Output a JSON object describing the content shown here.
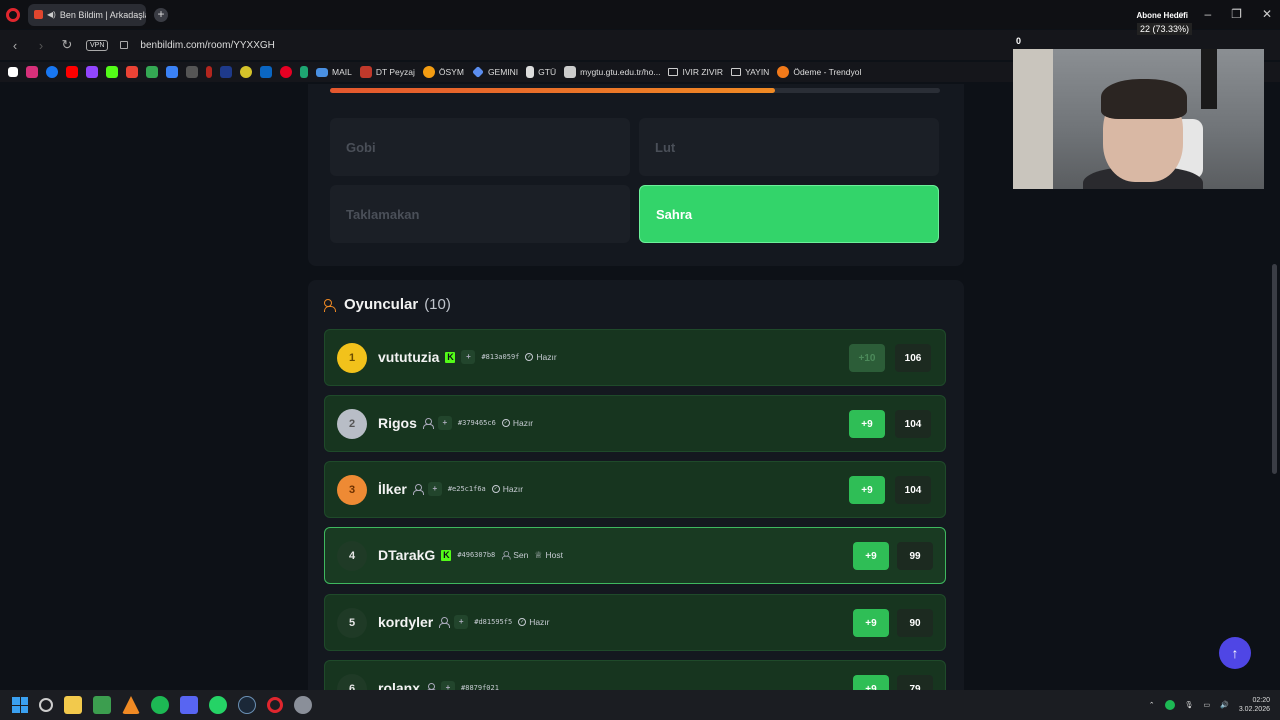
{
  "browser": {
    "tab_title": "Ben Bildim | Arkadaşla",
    "vpn_label": "VPN",
    "url": "benbildim.com/room/YYXXGH",
    "bookmarks": [
      "MAIL",
      "DT Peyzaj",
      "ÖSYM",
      "GEMINI",
      "GTÜ",
      "mygtu.gtu.edu.tr/ho...",
      "IVIR ZIVIR",
      "YAYIN",
      "Ödeme - Trendyol"
    ]
  },
  "stream_overlay": {
    "goal_label": "Abone Hedefi",
    "goal_value": "22 (73.33%)",
    "counter": "0"
  },
  "quiz": {
    "progress": 0.73,
    "options": [
      "Gobi",
      "Lut",
      "Taklamakan",
      "Sahra"
    ],
    "correct_option": "Sahra"
  },
  "players": {
    "title": "Oyuncular",
    "count": "(10)",
    "list": [
      {
        "rank": "1",
        "name": "vututuzia",
        "id": "#813a059f",
        "status": "Hazır",
        "gain": "+10",
        "score": "106"
      },
      {
        "rank": "2",
        "name": "Rigos",
        "id": "#379465c6",
        "status": "Hazır",
        "gain": "+9",
        "score": "104"
      },
      {
        "rank": "3",
        "name": "İlker",
        "id": "#e25c1f6a",
        "status": "Hazır",
        "gain": "+9",
        "score": "104"
      },
      {
        "rank": "4",
        "name": "DTarakG",
        "id": "#496307b8",
        "you_label": "Sen",
        "host_label": "Host",
        "gain": "+9",
        "score": "99"
      },
      {
        "rank": "5",
        "name": "kordyler",
        "id": "#d81595f5",
        "status": "Hazır",
        "gain": "+9",
        "score": "90"
      },
      {
        "rank": "6",
        "name": "rolanx",
        "id": "#8879f021",
        "status": "",
        "gain": "+9",
        "score": "79"
      }
    ]
  },
  "taskbar": {
    "time": "02:20",
    "date": "3.02.2026"
  },
  "colors": {
    "accent_orange": "#f08a24",
    "correct_green": "#33d46a",
    "row_green": "#17351f",
    "scroll_button": "#4f46e5"
  }
}
